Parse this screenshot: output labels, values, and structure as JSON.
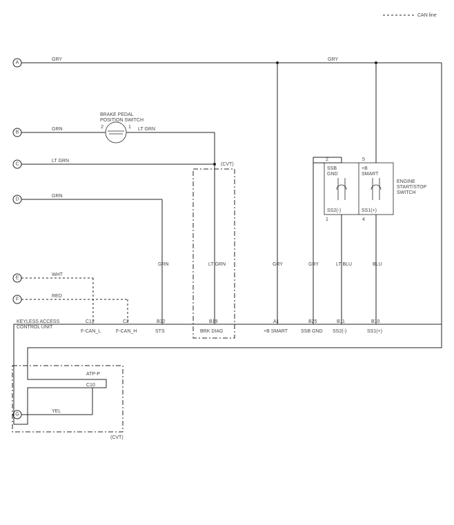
{
  "legend": {
    "can_line": "CAN line"
  },
  "terminals": {
    "A": "A",
    "B": "B",
    "C": "C",
    "D": "D",
    "E": "E",
    "F": "F",
    "G": "G"
  },
  "wire_colors": {
    "A_left": "GRY",
    "A_right": "GRY",
    "B_left": "GRN",
    "B_right": "LT GRN",
    "C_left": "LT GRN",
    "D_left": "GRN",
    "E_left": "WHT",
    "F_left": "RED",
    "G_left": "YEL",
    "col_sts": "GRN",
    "col_brk": "LT GRN",
    "col_bsmart": "GRY",
    "col_ssbgnd": "GRY",
    "col_ss2": "LT BLU",
    "col_ss1": "BLU"
  },
  "components": {
    "brake_switch": {
      "label1": "BRAKE PEDAL",
      "label2": "POSITION SWITCH",
      "pin_left": "2",
      "pin_right": "1"
    },
    "engine_switch": {
      "label1": "ENGINE",
      "label2": "START/STOP",
      "label3": "SWITCH",
      "pin_top_left": "2",
      "pin_top_right": "5",
      "pin_bot_left": "1",
      "pin_bot_right": "4",
      "text_top_left1": "SSB",
      "text_top_left2": "GND",
      "text_top_right1": "+B",
      "text_top_right2": "SMART",
      "text_bot_left": "SS2(-)",
      "text_bot_right": "SS1(+)"
    },
    "cvt_top": "(CVT)",
    "cvt_bottom": "(CVT)"
  },
  "control_unit": {
    "title1": "KEYLESS ACCESS",
    "title2": "CONTROL UNIT",
    "pins_top": {
      "C12": {
        "num": "C12",
        "name": "F-CAN_L"
      },
      "C2": {
        "num": "C2",
        "name": "F-CAN_H"
      },
      "B32": {
        "num": "B32",
        "name": "STS"
      },
      "B19": {
        "num": "B19",
        "name": "BRK DIAG"
      },
      "A1": {
        "num": "A1",
        "name": "+B SMART"
      },
      "B25": {
        "num": "B25",
        "name": "SSB GND"
      },
      "B11": {
        "num": "B11",
        "name": "SS2(-)"
      },
      "B10": {
        "num": "B10",
        "name": "SS1(+)"
      }
    },
    "pins_bottom": {
      "C10": {
        "num": "C10",
        "name": "ATP-P"
      }
    }
  },
  "chart_data": {
    "type": "wiring_diagram",
    "external_terminals": [
      "A",
      "B",
      "C",
      "D",
      "E",
      "F",
      "G"
    ],
    "wires": [
      {
        "from": "A",
        "color": "GRY",
        "to": "bus_top"
      },
      {
        "from": "bus_top",
        "color": "GRY",
        "to": "+B SMART / Engine Switch pin5"
      },
      {
        "from": "B",
        "color": "GRN",
        "to": "Brake Pedal Position Switch pin2"
      },
      {
        "from": "Brake Pedal Position Switch pin1",
        "color": "LT GRN",
        "to": "bus (BRK DIAG)"
      },
      {
        "from": "C",
        "color": "LT GRN",
        "to": "(CVT) group / BRK DIAG"
      },
      {
        "from": "D",
        "color": "GRN",
        "to": "KACU B32 STS"
      },
      {
        "from": "E",
        "color": "WHT",
        "can": true,
        "to": "KACU C12 F-CAN_L"
      },
      {
        "from": "F",
        "color": "RED",
        "can": true,
        "to": "KACU C2 F-CAN_H"
      },
      {
        "from": "G",
        "color": "YEL",
        "to": "KACU C10 ATP-P (via CVT)"
      },
      {
        "from": "KACU A1",
        "name": "+B SMART",
        "color": "GRY",
        "to": "bus_top"
      },
      {
        "from": "KACU B25",
        "name": "SSB GND",
        "color": "GRY",
        "to": "Engine Switch pin2"
      },
      {
        "from": "KACU B11",
        "name": "SS2(-)",
        "color": "LT BLU",
        "to": "Engine Switch pin1"
      },
      {
        "from": "KACU B10",
        "name": "SS1(+)",
        "color": "BLU",
        "to": "Engine Switch pin4"
      }
    ],
    "components": [
      {
        "name": "Brake Pedal Position Switch",
        "pins": [
          "1",
          "2"
        ]
      },
      {
        "name": "Engine Start/Stop Switch",
        "pins": [
          "1",
          "2",
          "4",
          "5"
        ],
        "internal": [
          "SSB GND",
          "+B SMART",
          "SS2(-)",
          "SS1(+)"
        ]
      },
      {
        "name": "Keyless Access Control Unit",
        "pins_top": [
          "C12",
          "C2",
          "B32",
          "B19",
          "A1",
          "B25",
          "B11",
          "B10"
        ],
        "pins_bottom": [
          "C10"
        ]
      }
    ],
    "groups": [
      {
        "name": "CVT",
        "members": [
          "B19 BRK DIAG branch"
        ]
      },
      {
        "name": "CVT",
        "members": [
          "C10 ATP-P branch"
        ]
      }
    ]
  }
}
